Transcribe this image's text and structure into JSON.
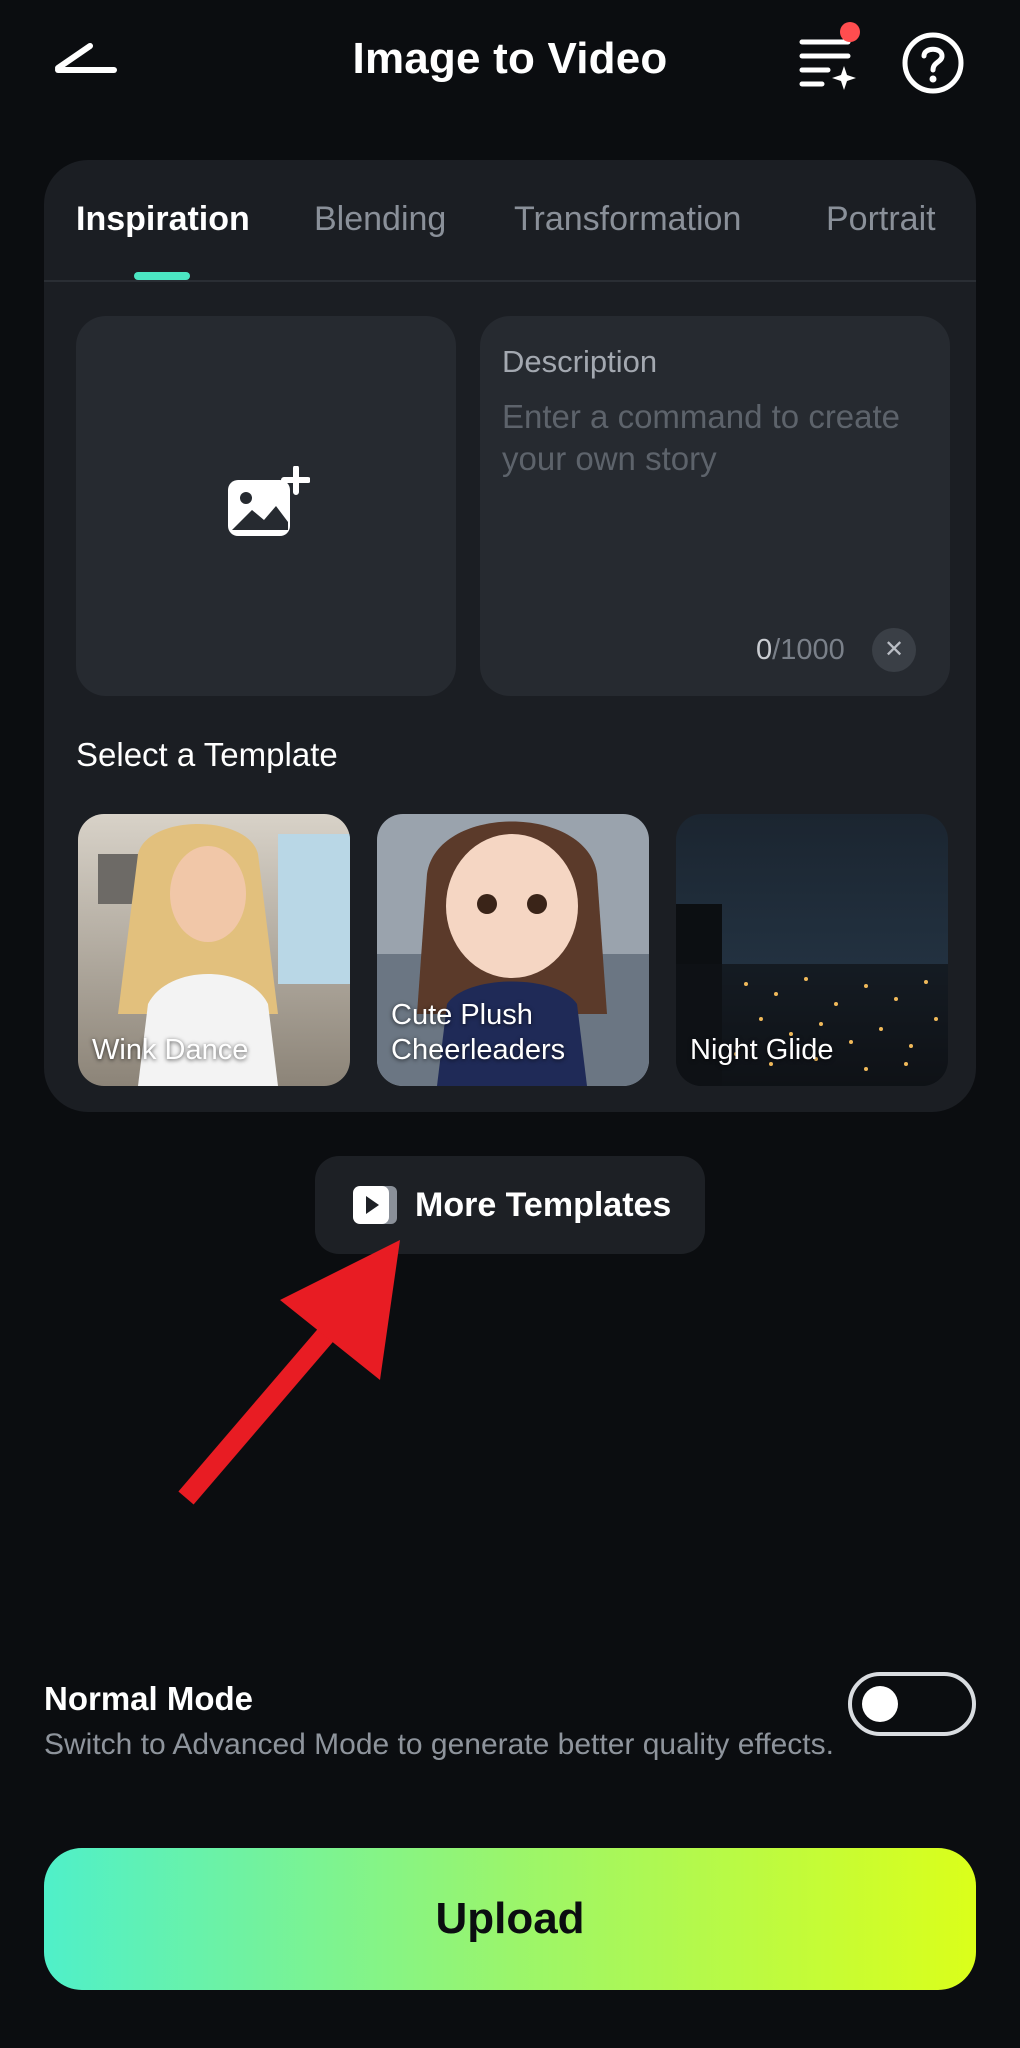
{
  "header": {
    "title": "Image to Video",
    "back_icon": "back-arrow-icon",
    "tasks_icon": "task-list-sparkle-icon",
    "help_icon": "help-circle-icon",
    "notification_dot_color": "#ff4d4f"
  },
  "tabs": [
    {
      "label": "Inspiration",
      "active": true
    },
    {
      "label": "Blending",
      "active": false
    },
    {
      "label": "Transformation",
      "active": false
    },
    {
      "label": "Portrait",
      "active": false
    }
  ],
  "upload_area": {
    "icon": "add-image-icon"
  },
  "description": {
    "label": "Description",
    "placeholder": "Enter a command to create your own story",
    "value": "",
    "count": "0",
    "max": "/1000",
    "clear_icon": "clear-icon"
  },
  "templates_section": {
    "title": "Select a Template",
    "items": [
      {
        "label": "Wink Dance"
      },
      {
        "label": "Cute Plush\nCheerleaders"
      },
      {
        "label": "Night Glide"
      }
    ]
  },
  "more_templates": {
    "label": "More Templates",
    "icon": "play-video-icon"
  },
  "mode": {
    "title": "Normal Mode",
    "description": "Switch to Advanced Mode to generate better quality effects.",
    "advanced_enabled": false
  },
  "upload_button": {
    "label": "Upload"
  },
  "colors": {
    "accent": "#4be6c2",
    "gradient_start": "#4ff0c9",
    "gradient_end": "#dbff1a",
    "annotation_arrow": "#e81c23"
  }
}
